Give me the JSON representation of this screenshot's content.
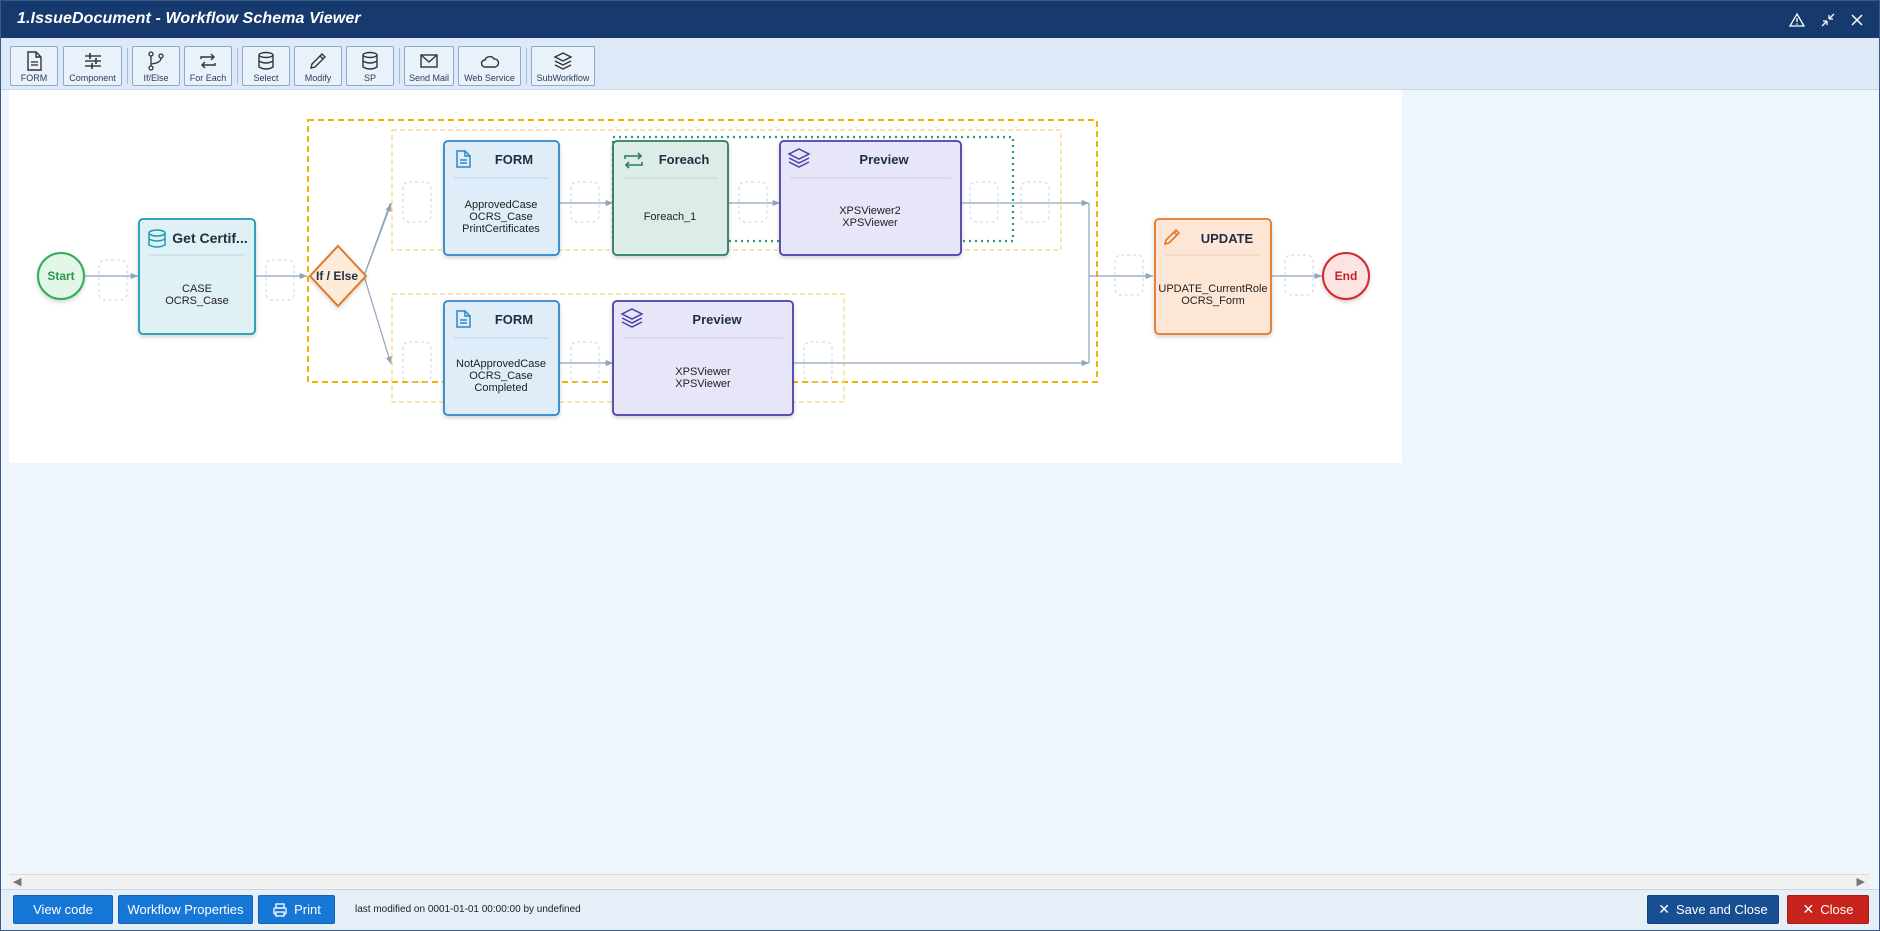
{
  "window": {
    "title": "1.IssueDocument - Workflow Schema Viewer"
  },
  "toolbar": {
    "items": [
      {
        "label": "FORM",
        "icon": "form-icon"
      },
      {
        "label": "Component",
        "icon": "sliders-icon"
      },
      {
        "label": "If/Else",
        "icon": "branch-icon"
      },
      {
        "label": "For Each",
        "icon": "loop-icon"
      },
      {
        "label": "Select",
        "icon": "database-icon"
      },
      {
        "label": "Modify",
        "icon": "pencil-icon"
      },
      {
        "label": "SP",
        "icon": "database-icon"
      },
      {
        "label": "Send Mail",
        "icon": "mail-icon"
      },
      {
        "label": "Web Service",
        "icon": "cloud-icon"
      },
      {
        "label": "SubWorkflow",
        "icon": "layers-icon"
      }
    ]
  },
  "diagram": {
    "start": "Start",
    "end": "End",
    "nodes": {
      "get_cert": {
        "title": "Get Certif...",
        "lines": [
          "CASE",
          "OCRS_Case"
        ]
      },
      "ifelse": {
        "title": "If / Else"
      },
      "form_approved": {
        "title": "FORM",
        "lines": [
          "ApprovedCase",
          "OCRS_Case",
          "PrintCertificates"
        ]
      },
      "foreach": {
        "title": "Foreach",
        "lines": [
          "Foreach_1"
        ]
      },
      "preview_1": {
        "title": "Preview",
        "lines": [
          "XPSViewer2",
          "XPSViewer"
        ]
      },
      "form_notapproved": {
        "title": "FORM",
        "lines": [
          "NotApprovedCase",
          "OCRS_Case",
          "Completed"
        ]
      },
      "preview_2": {
        "title": "Preview",
        "lines": [
          "XPSViewer",
          "XPSViewer"
        ]
      },
      "update": {
        "title": "UPDATE",
        "lines": [
          "UPDATE_CurrentRole",
          "OCRS_Form"
        ]
      }
    }
  },
  "colors": {
    "teal": "#1a9bb0",
    "blue": "#2f86c8",
    "green": "#2d7a64",
    "purple": "#4a3fa8",
    "orange": "#e0782a",
    "dashed_gold": "#f0b400",
    "end_red": "#d22b2b",
    "start_green": "#2eae57"
  },
  "footer": {
    "view_code": "View code",
    "workflow_properties": "Workflow Properties",
    "print": "Print",
    "meta": "last modified on 0001-01-01 00:00:00 by undefined",
    "save_close": "Save and Close",
    "close": "Close"
  }
}
